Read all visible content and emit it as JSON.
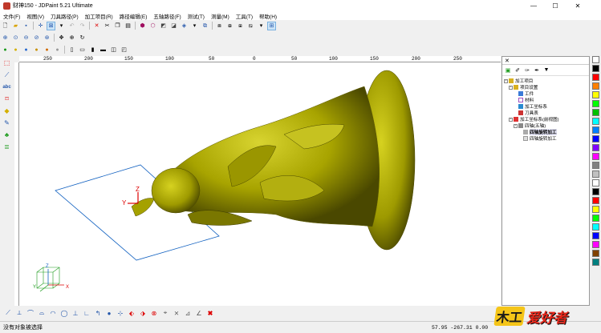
{
  "window": {
    "title": "财神150 - JDPaint 5.21 Ultimate",
    "minimize": "—",
    "maximize": "☐",
    "close": "✕"
  },
  "menu": [
    "文件(F)",
    "视图(V)",
    "刀具路径(P)",
    "加工项目(R)",
    "路径编辑(E)",
    "五轴路径(F)",
    "测试(T)",
    "测量(M)",
    "工具(T)",
    "帮助(H)"
  ],
  "ruler": {
    "ticks": [
      "250",
      "200",
      "150",
      "100",
      "50",
      "0",
      "50",
      "100",
      "150",
      "200",
      "250"
    ]
  },
  "panel": {
    "close": "✕",
    "tree": [
      {
        "label": "加工项目",
        "level": 0,
        "icon": "project"
      },
      {
        "label": "项目设置",
        "level": 1,
        "icon": "settings"
      },
      {
        "label": "工件",
        "level": 2,
        "icon": "workpiece"
      },
      {
        "label": "材料",
        "level": 2,
        "icon": "material"
      },
      {
        "label": "加工坐标系",
        "level": 2,
        "icon": "axes"
      },
      {
        "label": "刀具表",
        "level": 2,
        "icon": "tool"
      },
      {
        "label": "加工坐标系(前视图)",
        "level": 1,
        "icon": "axes"
      },
      {
        "label": "四轴(五轴)",
        "level": 2,
        "icon": "group"
      },
      {
        "label": "四轴旋转加工",
        "level": 3,
        "icon": "path",
        "selected": true
      },
      {
        "label": "四轴旋转加工",
        "level": 3,
        "icon": "path"
      }
    ]
  },
  "palette": [
    "#ffffff",
    "#000000",
    "#ff0000",
    "#ff8000",
    "#ffff00",
    "#00ff00",
    "#00c000",
    "#00ffff",
    "#0080ff",
    "#0000ff",
    "#8000ff",
    "#ff00ff",
    "#808080",
    "#c0c0c0",
    "#ffffff",
    "#000000",
    "#ff0000",
    "#ffff00",
    "#00ff00",
    "#00ffff",
    "#0000ff",
    "#ff00ff",
    "#804000",
    "#008080"
  ],
  "axes": {
    "x": "X",
    "y": "Y",
    "z": "Z"
  },
  "status": {
    "message": "没有对象被选择",
    "coords": "57.95  -267.31  0.00"
  },
  "watermark": {
    "part1": "木工",
    "part2": "爱好者"
  },
  "colors": {
    "model": "#b5b300",
    "model_dark": "#5c5a00",
    "selection": "#1060c0"
  }
}
